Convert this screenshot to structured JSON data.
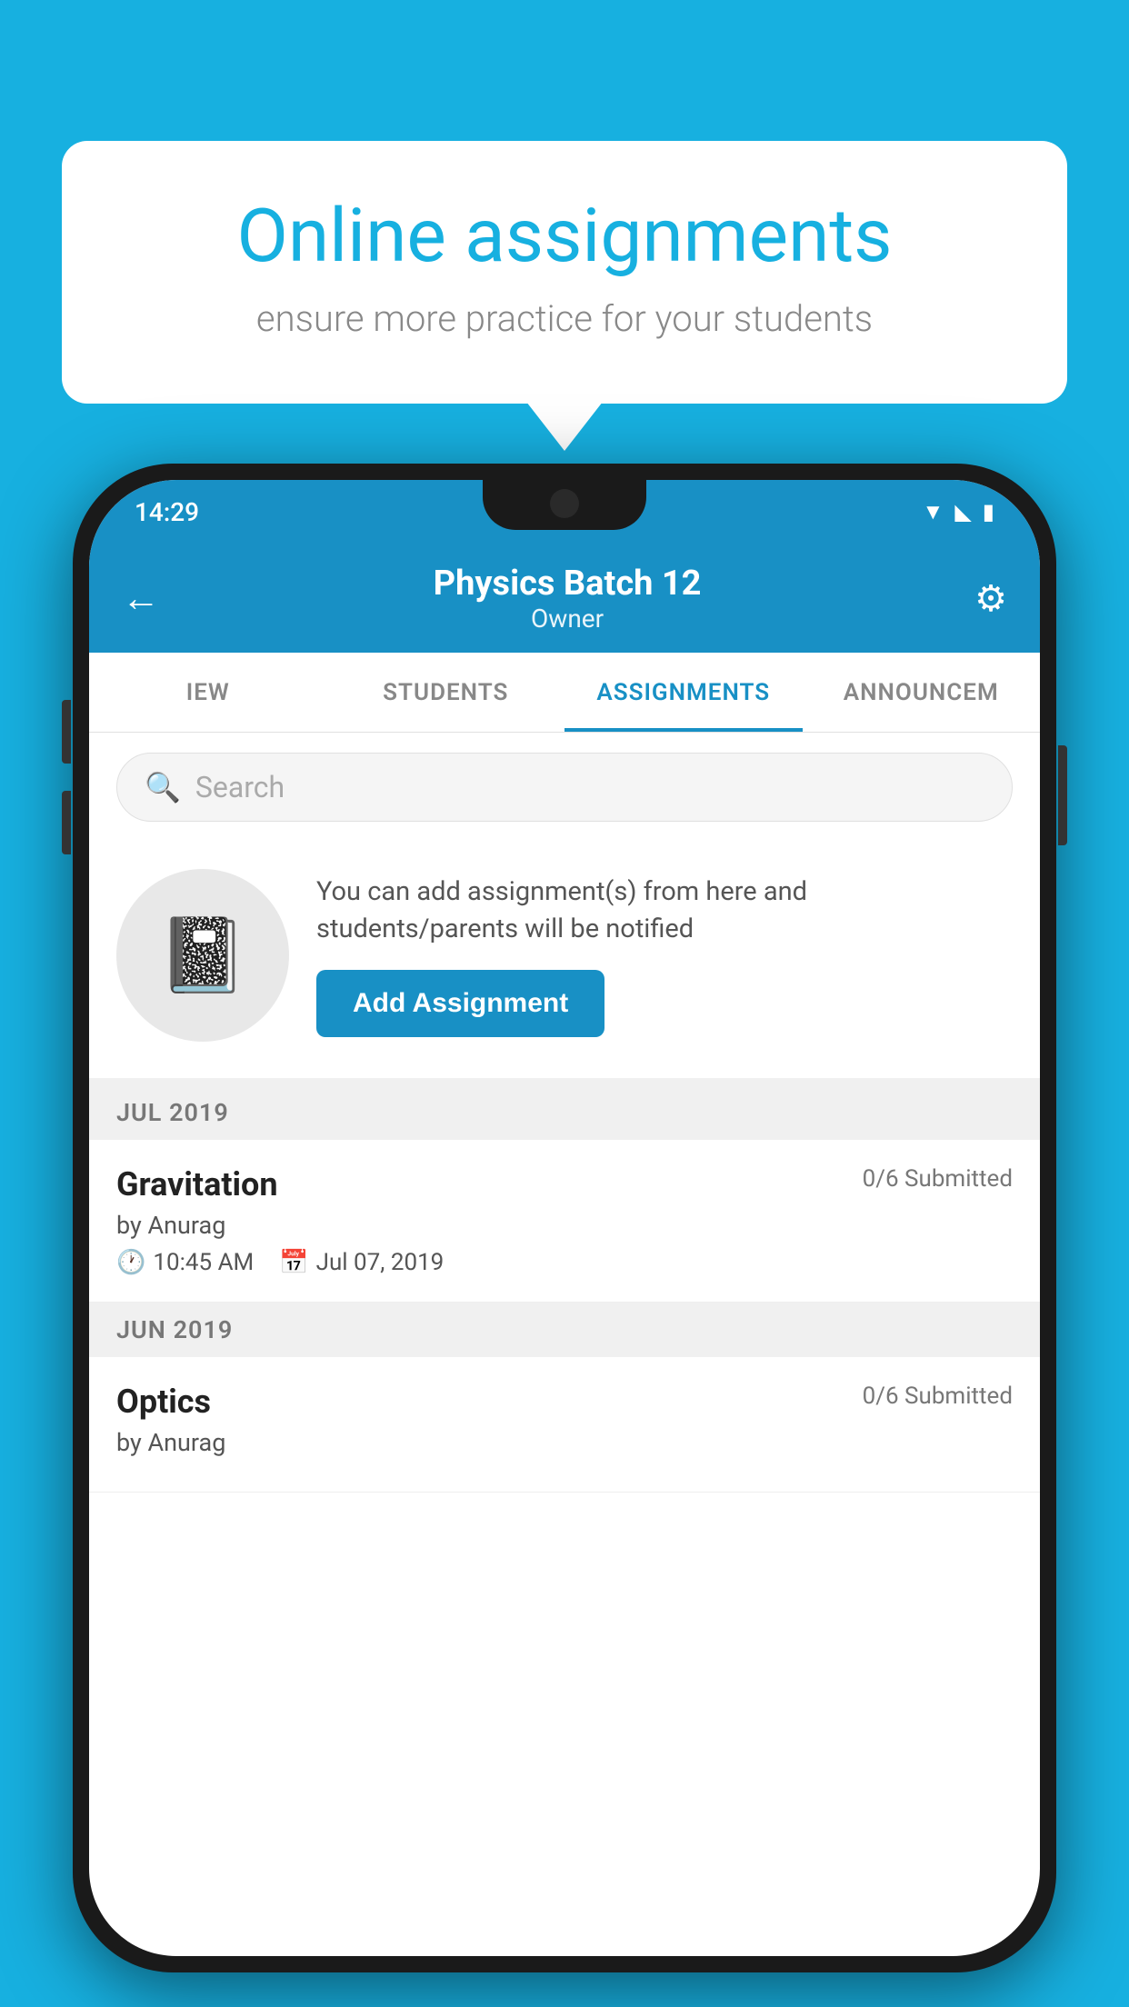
{
  "background_color": "#17b0e0",
  "bubble": {
    "title": "Online assignments",
    "subtitle": "ensure more practice for your students"
  },
  "phone": {
    "status_bar": {
      "time": "14:29",
      "icons": [
        "wifi",
        "signal",
        "battery"
      ]
    },
    "header": {
      "title": "Physics Batch 12",
      "subtitle": "Owner"
    },
    "tabs": [
      {
        "label": "IEW",
        "active": false
      },
      {
        "label": "STUDENTS",
        "active": false
      },
      {
        "label": "ASSIGNMENTS",
        "active": true
      },
      {
        "label": "ANNOUNCEM",
        "active": false
      }
    ],
    "search": {
      "placeholder": "Search"
    },
    "promo": {
      "text": "You can add assignment(s) from here and students/parents will be notified",
      "button_label": "Add Assignment"
    },
    "sections": [
      {
        "month_label": "JUL 2019",
        "assignments": [
          {
            "name": "Gravitation",
            "submitted": "0/6 Submitted",
            "by": "by Anurag",
            "time": "10:45 AM",
            "date": "Jul 07, 2019"
          }
        ]
      },
      {
        "month_label": "JUN 2019",
        "assignments": [
          {
            "name": "Optics",
            "submitted": "0/6 Submitted",
            "by": "by Anurag",
            "time": "",
            "date": ""
          }
        ]
      }
    ]
  }
}
